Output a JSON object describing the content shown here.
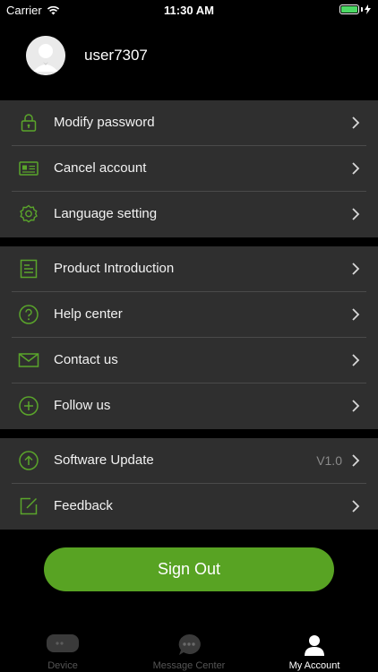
{
  "status_bar": {
    "carrier": "Carrier",
    "time": "11:30 AM"
  },
  "profile": {
    "username": "user7307"
  },
  "groups": [
    {
      "items": [
        {
          "label": "Modify password",
          "icon": "lock-icon"
        },
        {
          "label": "Cancel account",
          "icon": "id-card-icon"
        },
        {
          "label": "Language setting",
          "icon": "gear-icon"
        }
      ]
    },
    {
      "items": [
        {
          "label": "Product Introduction",
          "icon": "document-icon"
        },
        {
          "label": "Help center",
          "icon": "question-icon"
        },
        {
          "label": "Contact us",
          "icon": "mail-icon"
        },
        {
          "label": "Follow us",
          "icon": "plus-circle-icon"
        }
      ]
    },
    {
      "items": [
        {
          "label": "Software Update",
          "icon": "up-arrow-circle-icon",
          "value": "V1.0"
        },
        {
          "label": "Feedback",
          "icon": "edit-icon"
        }
      ]
    }
  ],
  "sign_out": {
    "label": "Sign Out"
  },
  "tabs": [
    {
      "label": "Device",
      "icon": "device-icon",
      "active": false
    },
    {
      "label": "Message Center",
      "icon": "chat-bubble-icon",
      "active": false
    },
    {
      "label": "My Account",
      "icon": "person-icon",
      "active": true
    }
  ],
  "colors": {
    "accent": "#58a323",
    "icon_green": "#5aa52b",
    "row_bg": "#2f2f2f",
    "background": "#000000"
  }
}
